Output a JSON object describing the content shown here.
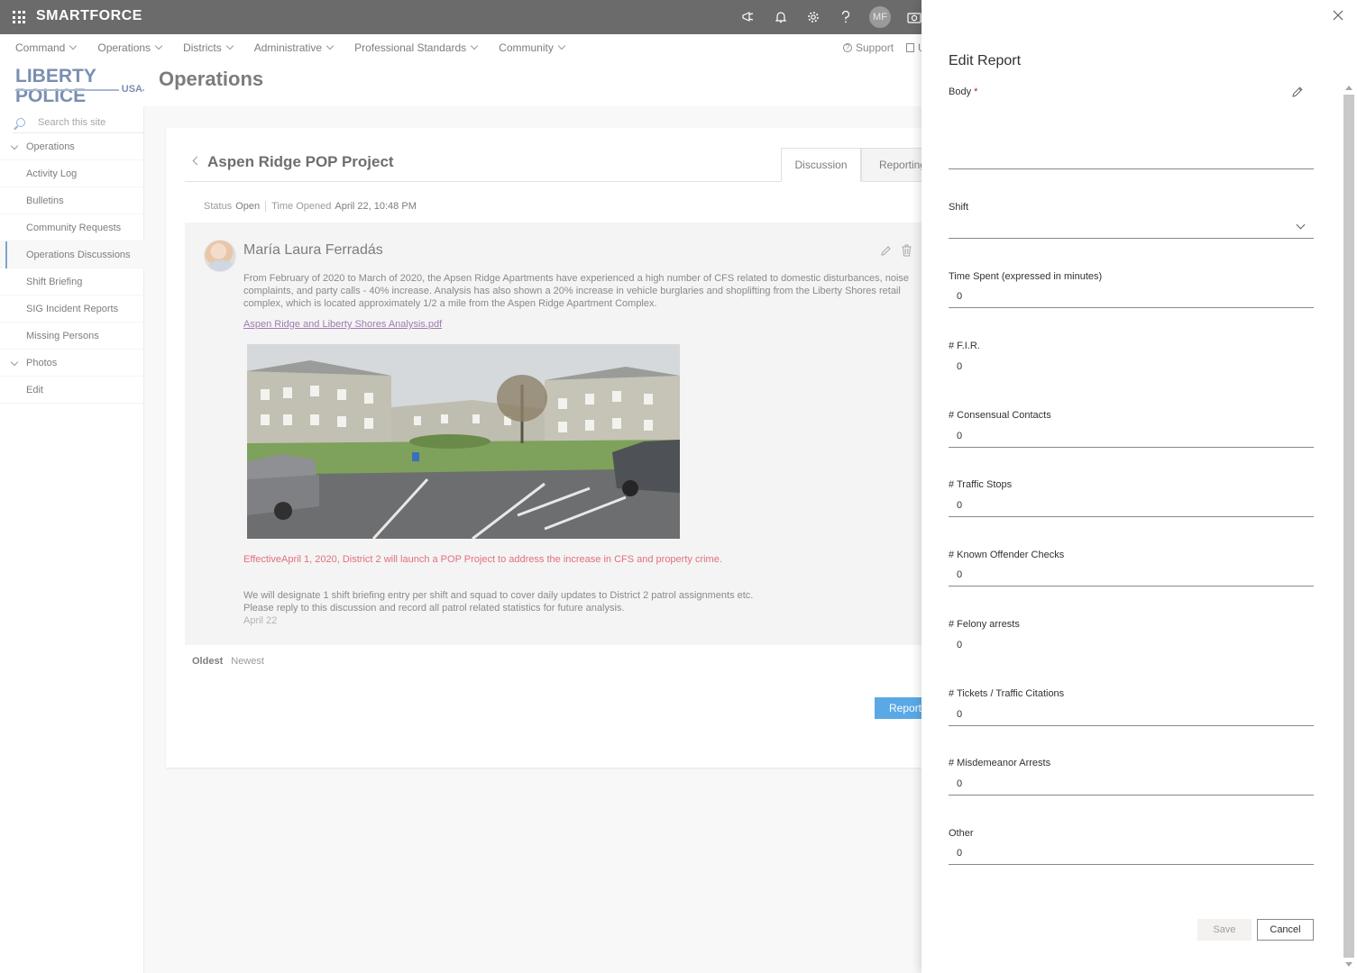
{
  "suite": {
    "brand": "SMARTFORCE",
    "avatar_initials": "MF"
  },
  "hubnav": {
    "items": [
      "Command",
      "Operations",
      "Districts",
      "Administrative",
      "Professional Standards",
      "Community"
    ],
    "support": "Support",
    "trailing": "U"
  },
  "site": {
    "logo_line1": "LIBERTY POLICE",
    "logo_line2": "USA",
    "title": "Operations"
  },
  "leftnav": {
    "search_placeholder": "Search this site",
    "items": [
      {
        "label": "Operations",
        "group": true
      },
      {
        "label": "Activity Log"
      },
      {
        "label": "Bulletins"
      },
      {
        "label": "Community Requests"
      },
      {
        "label": "Operations Discussions",
        "active": true
      },
      {
        "label": "Shift Briefing"
      },
      {
        "label": "SIG Incident Reports"
      },
      {
        "label": "Missing Persons"
      },
      {
        "label": "Photos",
        "group": true
      },
      {
        "label": "Edit"
      }
    ]
  },
  "discussion": {
    "title": "Aspen Ridge POP Project",
    "tabs": [
      "Discussion",
      "Reporting"
    ],
    "status_label": "Status",
    "status_value": "Open",
    "time_opened_label": "Time Opened",
    "time_opened_value": "April 22, 10:48 PM",
    "author": "María Laura Ferradás",
    "body": "From February of 2020 to March of 2020, the Apsen Ridge Apartments have experienced a high number of CFS related to domestic disturbances, noise complaints, and party calls - 40% increase. Analysis has also shown a 20% increase in vehicle burglaries and shoplifting from the Liberty Shores retail complex, which is located approximately 1/2 a mile from the Aspen Ridge Apartment Complex.",
    "attachment": "Aspen Ridge and Liberty Shores Analysis.pdf",
    "highlight": "EffectiveApril 1, 2020, District 2 will launch a POP Project to address the increase in CFS and property crime.",
    "body2_line1": "We will designate 1 shift briefing entry per shift and squad to cover daily updates to District 2 patrol assignments etc.",
    "body2_line2": "Please reply to this discussion and record all patrol related statistics for future analysis.",
    "date": "April 22",
    "sort_oldest": "Oldest",
    "sort_newest": "Newest",
    "report_button": "Report"
  },
  "panel": {
    "title": "Edit Report",
    "body_label": "Body",
    "required_mark": "*",
    "shift_label": "Shift",
    "fields": [
      {
        "label": "Time Spent (expressed in minutes)",
        "value": "0"
      },
      {
        "label": "# F.I.R.",
        "value": "0"
      },
      {
        "label": "# Consensual Contacts",
        "value": "0"
      },
      {
        "label": "# Traffic Stops",
        "value": "0"
      },
      {
        "label": "# Known Offender Checks",
        "value": "0"
      },
      {
        "label": "# Felony arrests",
        "value": "0"
      },
      {
        "label": "# Tickets / Traffic Citations",
        "value": "0"
      },
      {
        "label": "# Misdemeanor Arrests",
        "value": "0"
      },
      {
        "label": "Other",
        "value": "0"
      }
    ],
    "save_label": "Save",
    "cancel_label": "Cancel"
  }
}
